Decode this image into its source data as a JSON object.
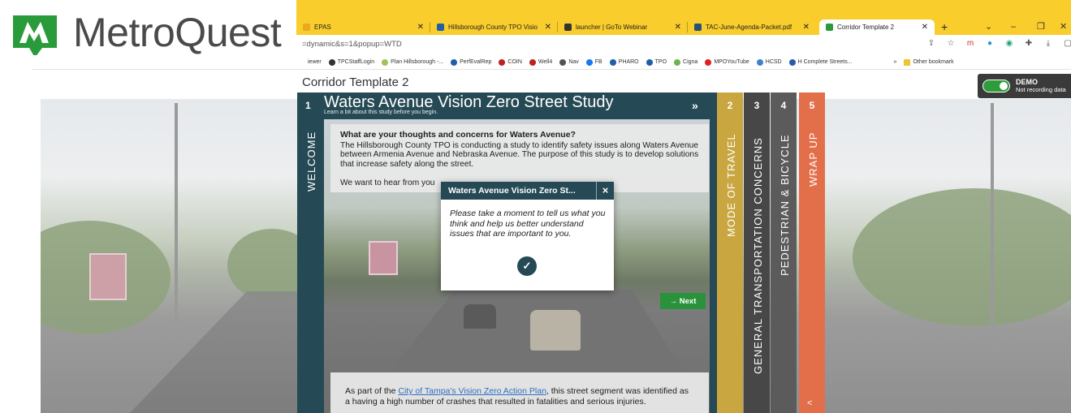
{
  "logo": {
    "text": "MetroQuest",
    "color": "#2a9b3a"
  },
  "browser": {
    "tabs": [
      {
        "label": "EPAS",
        "favicon_color": "#e8a920"
      },
      {
        "label": "Hillsborough County TPO Visio",
        "favicon_color": "#1e5fa8"
      },
      {
        "label": "launcher | GoTo Webinar",
        "favicon_color": "#333333"
      },
      {
        "label": "TAC-June-Agenda-Packet.pdf",
        "favicon_color": "#24507a"
      },
      {
        "label": "Corridor Template 2",
        "favicon_color": "#2a9b3a"
      }
    ],
    "new_tab_label": "+",
    "url": "=dynamic&s=1&popup=WTD",
    "bookmarks": [
      "iewer",
      "TPCStaffLogin",
      "Plan Hillsborough -...",
      "PerfEvalRep",
      "COIN",
      "Well4",
      "Nav",
      "FB",
      "PHARO",
      "TPO",
      "Cigna",
      "MPOYouTube",
      "HCSD",
      "H Complete Streets..."
    ],
    "bookmarks_more": "»",
    "other_bookmarks": "Other bookmark"
  },
  "page": {
    "survey_title": "Corridor Template 2",
    "demo": {
      "title": "DEMO",
      "subtitle": "Not recording data"
    }
  },
  "panel": {
    "number": "1",
    "vertical_label": "WELCOME",
    "title": "Waters Avenue Vision Zero Street Study",
    "subtitle": "Learn a bit about this study before you begin.",
    "expand_icon": "»",
    "question": "What are your thoughts and concerns for Waters Avenue?",
    "intro": "The Hillsborough County TPO is conducting a study to identify safety issues along Waters Avenue between Armenia Avenue and Nebraska Avenue. The purpose of this study is to develop solutions that increase safety along the street.",
    "hear": "We want to hear from you",
    "next_label": "→ Next",
    "bottom_prefix": "As part of the ",
    "bottom_link": "City of Tampa's Vision Zero Action Plan",
    "bottom_suffix": ", this street segment was identified as a having a high number of crashes that resulted in fatalities and serious injuries."
  },
  "popup": {
    "title": "Waters Avenue Vision Zero St...",
    "close_icon": "×",
    "body": "Please take a moment to tell us what you think and help us better understand issues that are important to you.",
    "ok_icon": "✓"
  },
  "side_tabs": [
    {
      "number": "2",
      "label": "MODE OF TRAVEL",
      "color": "#c9a63f"
    },
    {
      "number": "3",
      "label": "GENERAL TRANSPORTATION CONCERNS",
      "color": "#474747"
    },
    {
      "number": "4",
      "label": "PEDESTRIAN & BICYCLE",
      "color": "#5b5b5b"
    },
    {
      "number": "5",
      "label": "WRAP UP",
      "color": "#e36f4a"
    }
  ],
  "share_icon": "<"
}
